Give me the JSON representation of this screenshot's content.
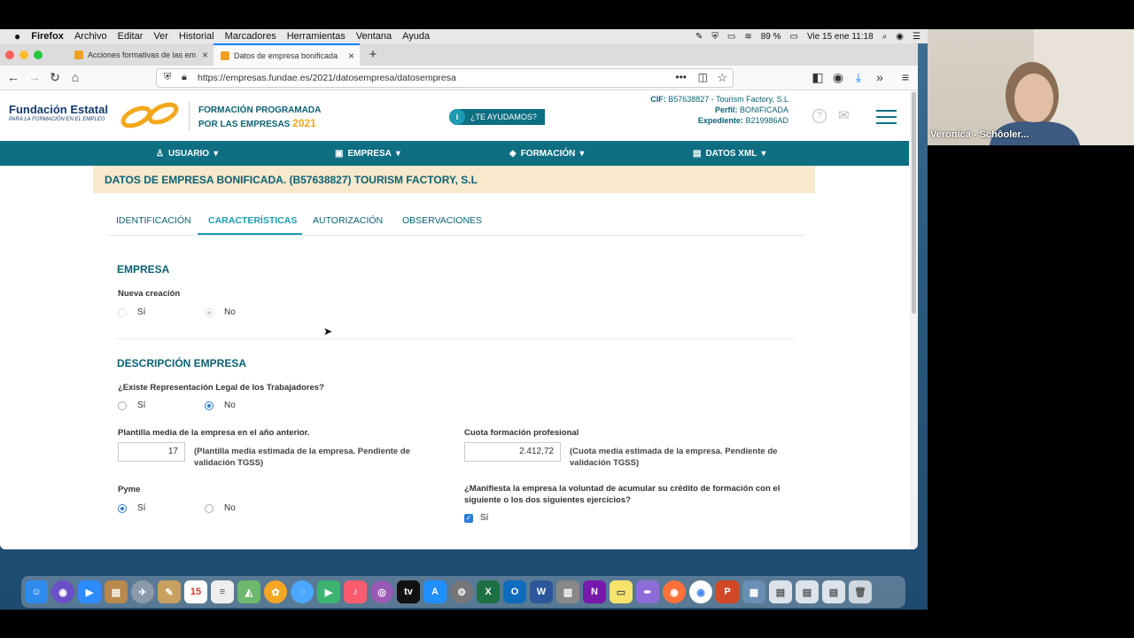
{
  "menubar": {
    "apple": "",
    "app": "Firefox",
    "items": [
      "Archivo",
      "Editar",
      "Ver",
      "Historial",
      "Marcadores",
      "Herramientas",
      "Ventana",
      "Ayuda"
    ],
    "battery": "89 %",
    "datetime": "Vie 15 ene  11:18"
  },
  "tabs": [
    {
      "label": "Acciones formativas de las em"
    },
    {
      "label": "Datos de empresa bonificada"
    }
  ],
  "url": "https://empresas.fundae.es/2021/datosempresa/datosempresa",
  "header": {
    "logo_line1": "Fundación Estatal",
    "logo_line2": "PARA LA FORMACIÓN EN EL EMPLEO",
    "prog_line1": "FORMACIÓN PROGRAMADA",
    "prog_line2": "POR LAS EMPRESAS",
    "year": "2021",
    "help": "¿TE AYUDAMOS?",
    "cif_label": "CIF:",
    "cif_value": "B57638827 - Tourism Factory, S.L",
    "perfil_label": "Perfil:",
    "perfil_value": "BONIFICADA",
    "exp_label": "Expediente:",
    "exp_value": "B219986AD"
  },
  "nav": [
    "USUARIO",
    "EMPRESA",
    "FORMACIÓN",
    "DATOS XML"
  ],
  "page_title": "DATOS DE EMPRESA BONIFICADA. (B57638827) TOURISM FACTORY, S.L",
  "subtabs": [
    "IDENTIFICACIÓN",
    "CARACTERÍSTICAS",
    "AUTORIZACIÓN",
    "OBSERVACIONES"
  ],
  "section1": {
    "title": "EMPRESA",
    "field": "Nueva creación",
    "yes": "Sí",
    "no": "No"
  },
  "section2": {
    "title": "DESCRIPCIÓN EMPRESA",
    "rep_label": "¿Existe Representación Legal de los Trabajadores?",
    "yes": "Sí",
    "no": "No",
    "plantilla_label": "Plantilla media de la empresa en el año anterior.",
    "plantilla_value": "17",
    "plantilla_note": "(Plantilla media estimada de la empresa. Pendiente de validación TGSS)",
    "cuota_label": "Cuota formación profesional",
    "cuota_value": "2.412,72",
    "cuota_note": "(Cuota media estimada de la empresa. Pendiente de validación TGSS)",
    "pyme_label": "Pyme",
    "acumular_label": "¿Manifiesta la empresa la voluntad de acumular su crédito de formación con el siguiente o los dos siguientes ejercicios?",
    "acumular_yes": "Sí"
  },
  "video": {
    "name": "Veronica - Schôoler..."
  }
}
